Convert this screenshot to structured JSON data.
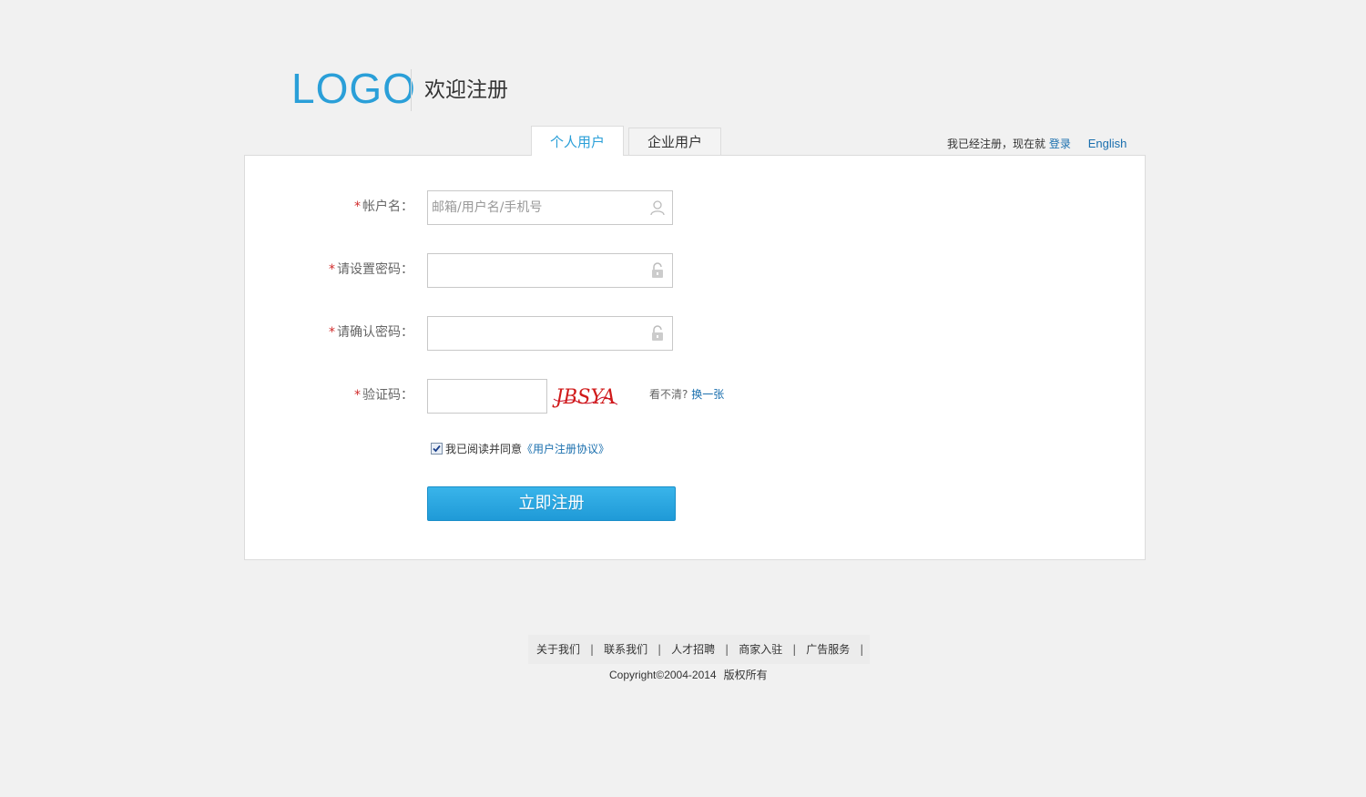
{
  "header": {
    "logo_text": "LOGO",
    "welcome_text": "欢迎注册"
  },
  "tabs": [
    {
      "label": "个人用户",
      "active": true
    },
    {
      "label": "企业用户",
      "active": false
    }
  ],
  "top_right": {
    "already_text": "我已经注册，现在就",
    "login_link": "登录",
    "english_link": "English"
  },
  "form": {
    "account": {
      "required_mark": "*",
      "label": "帐户名：",
      "placeholder": "邮箱/用户名/手机号",
      "value": "",
      "icon": "user-icon"
    },
    "password": {
      "required_mark": "*",
      "label": "请设置密码：",
      "value": "",
      "icon": "lock-icon"
    },
    "confirm_password": {
      "required_mark": "*",
      "label": "请确认密码：",
      "value": "",
      "icon": "lock-icon"
    },
    "captcha": {
      "required_mark": "*",
      "label": "验证码：",
      "value": "",
      "image_text": "JBSYA",
      "hint_text": "看不清?",
      "refresh_link": "换一张"
    },
    "agreement": {
      "checked": true,
      "text": "我已阅读并同意",
      "link": "《用户注册协议》"
    },
    "submit_label": "立即注册"
  },
  "footer": {
    "links": [
      "关于我们",
      "联系我们",
      "人才招聘",
      "商家入驻",
      "广告服务"
    ],
    "separator": "|",
    "copyright": "Copyright©2004-2014",
    "rights": "版权所有"
  },
  "colors": {
    "accent": "#2a9fd8",
    "link": "#1a6fae",
    "required": "#d12b2b",
    "background": "#f1f1f1"
  }
}
